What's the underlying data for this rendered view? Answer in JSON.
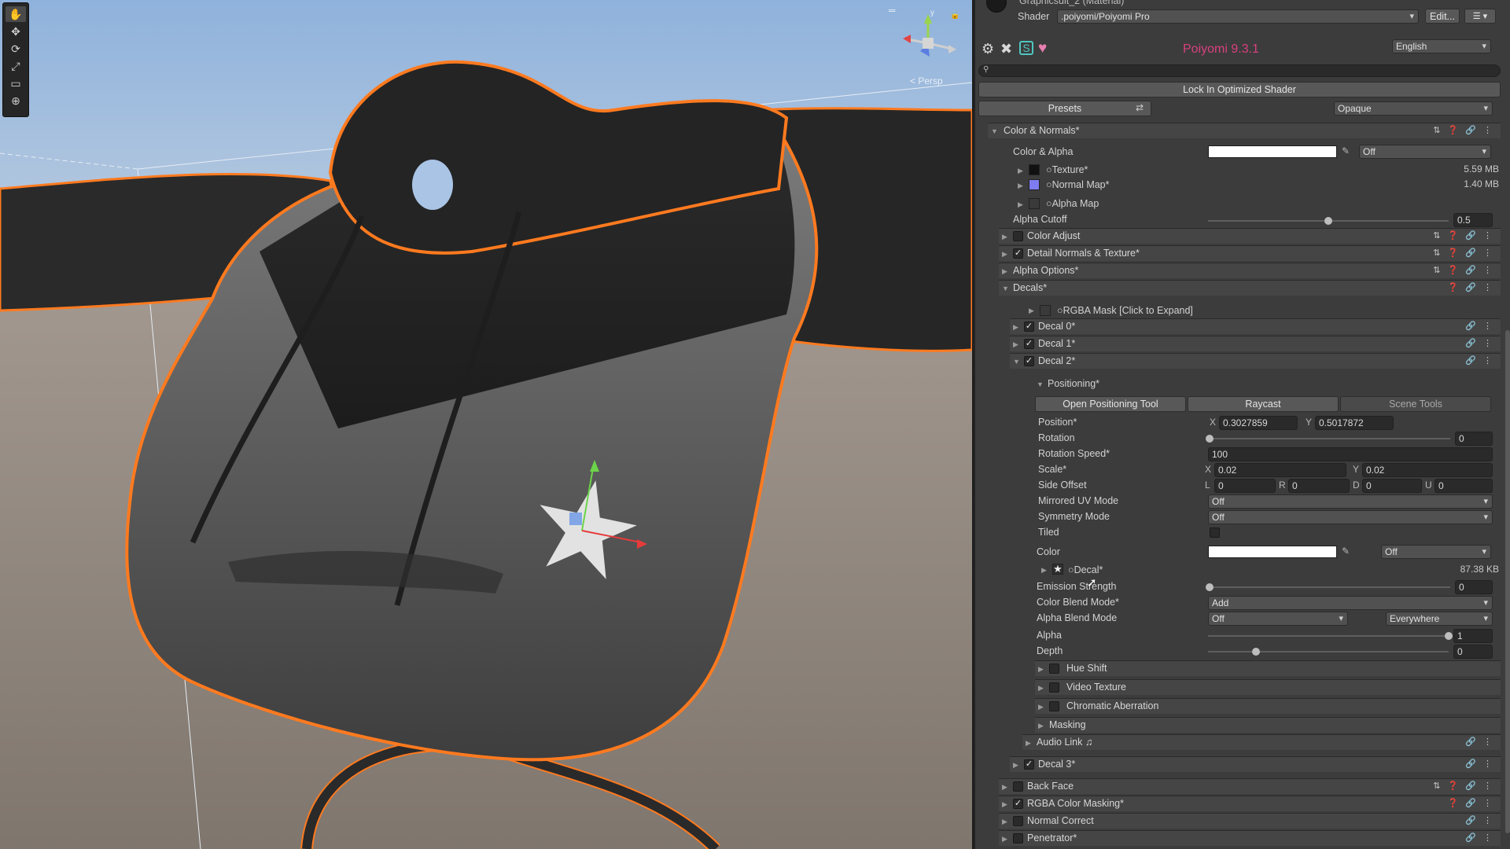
{
  "scene": {
    "persp_label": "< Persp",
    "menu_glyph": "═",
    "lock_glyph": "🔒",
    "gizmo_axis_label": "y",
    "tools": [
      "hand-icon",
      "move-icon",
      "rotate-icon",
      "scale-icon",
      "rect-icon",
      "transform-icon"
    ],
    "tool_glyphs": [
      "✋",
      "✥",
      "⟳",
      "⤢",
      "▭",
      "⊕"
    ]
  },
  "inspector": {
    "material_name": "Graphicsuit_2 (Material)",
    "shader_label": "Shader",
    "shader_value": ".poiyomi/Poiyomi Pro",
    "edit_label": "Edit...",
    "menu_glyph": "☰ ▾",
    "brand_title": "Poiyomi 9.3.1",
    "language": "English",
    "lock_button": "Lock In Optimized Shader",
    "presets_button": "Presets",
    "render_mode": "Opaque",
    "search_placeholder": ""
  },
  "sections": {
    "color_normals": "Color & Normals*",
    "color_alpha_label": "Color & Alpha",
    "color_alpha_mode": "Off",
    "texture_label": "Texture*",
    "texture_size": "5.59 MB",
    "normal_label": "Normal Map*",
    "normal_size": "1.40 MB",
    "alphamap_label": "Alpha Map",
    "alpha_cutoff_label": "Alpha Cutoff",
    "alpha_cutoff_value": "0.5",
    "color_adjust": "Color Adjust",
    "detail_normals": "Detail Normals & Texture*",
    "alpha_options": "Alpha Options*",
    "decals": "Decals*",
    "rgba_mask": "RGBA Mask [Click to Expand]",
    "decal0": "Decal 0*",
    "decal1": "Decal 1*",
    "decal2": "Decal 2*",
    "positioning": "Positioning*",
    "open_tool": "Open Positioning Tool",
    "raycast": "Raycast",
    "scene_tools": "Scene Tools",
    "position_label": "Position*",
    "position_x_label": "X",
    "position_x": "0.3027859",
    "position_y_label": "Y",
    "position_y": "0.5017872",
    "rotation_label": "Rotation",
    "rotation_value": "0",
    "rotation_speed_label": "Rotation Speed*",
    "rotation_speed_value": "100",
    "scale_label": "Scale*",
    "scale_x_label": "X",
    "scale_x": "0.02",
    "scale_y_label": "Y",
    "scale_y": "0.02",
    "side_offset_label": "Side Offset",
    "side_l_label": "L",
    "side_l": "0",
    "side_r_label": "R",
    "side_r": "0",
    "side_d_label": "D",
    "side_d": "0",
    "side_u_label": "U",
    "side_u": "0",
    "mirrored_label": "Mirrored UV Mode",
    "mirrored_value": "Off",
    "symmetry_label": "Symmetry Mode",
    "symmetry_value": "Off",
    "tiled_label": "Tiled",
    "color_label": "Color",
    "color_mode": "Off",
    "decal_tex_label": "Decal*",
    "decal_tex_size": "87.38 KB",
    "emission_label": "Emission Strength",
    "emission_value": "0",
    "color_blend_label": "Color Blend Mode*",
    "color_blend_value": "Add",
    "alpha_blend_label": "Alpha Blend Mode",
    "alpha_blend_value": "Off",
    "alpha_blend_where": "Everywhere",
    "alpha_label": "Alpha",
    "alpha_value": "1",
    "depth_label": "Depth",
    "depth_value": "0",
    "hue_shift": "Hue Shift",
    "video_texture": "Video Texture",
    "chromatic": "Chromatic Aberration",
    "masking": "Masking",
    "audio_link": "Audio Link ♫",
    "decal3": "Decal 3*",
    "back_face": "Back Face",
    "rgba_color_masking": "RGBA Color Masking*",
    "normal_correct": "Normal Correct",
    "penetrator": "Penetrator*"
  },
  "sliders": {
    "alpha_cutoff": 0.5,
    "rotation": 0,
    "emission_strength": 0,
    "alpha": 1,
    "depth": 0.2
  },
  "colors": {
    "brand": "#d8417e",
    "inspector_bg": "#3c3c3c",
    "outline": "#ff7a1f"
  }
}
